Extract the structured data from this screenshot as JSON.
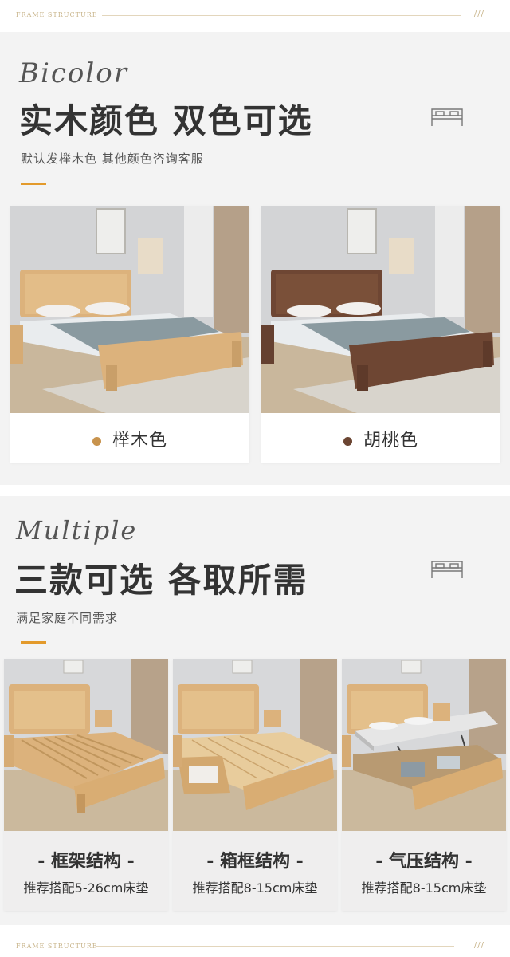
{
  "header": {
    "label": "FRAME STRUCTURE",
    "slashes": "///"
  },
  "footer": {
    "label": "FRAME STRUCTURE",
    "slashes": "///"
  },
  "section1": {
    "english": "Bicolor",
    "title": "实木颜色 双色可选",
    "subtitle": "默认发榉木色 其他颜色咨询客服",
    "icon": "bed-icon",
    "options": [
      {
        "name": "榉木色",
        "color": "#c8934d",
        "wood": "#dcb27c"
      },
      {
        "name": "胡桃色",
        "color": "#6b4532",
        "wood": "#6e4633"
      }
    ]
  },
  "section2": {
    "english": "Multiple",
    "title": "三款可选 各取所需",
    "subtitle": "满足家庭不同需求",
    "icon": "bed-icon",
    "options": [
      {
        "title": "- 框架结构 -",
        "sub": "推荐搭配5-26cm床垫"
      },
      {
        "title": "- 箱框结构 -",
        "sub": "推荐搭配8-15cm床垫"
      },
      {
        "title": "- 气压结构 -",
        "sub": "推荐搭配8-15cm床垫"
      }
    ]
  },
  "colors": {
    "accent": "#e39a2b",
    "beech": "#dcb27c",
    "walnut": "#6e4633"
  }
}
